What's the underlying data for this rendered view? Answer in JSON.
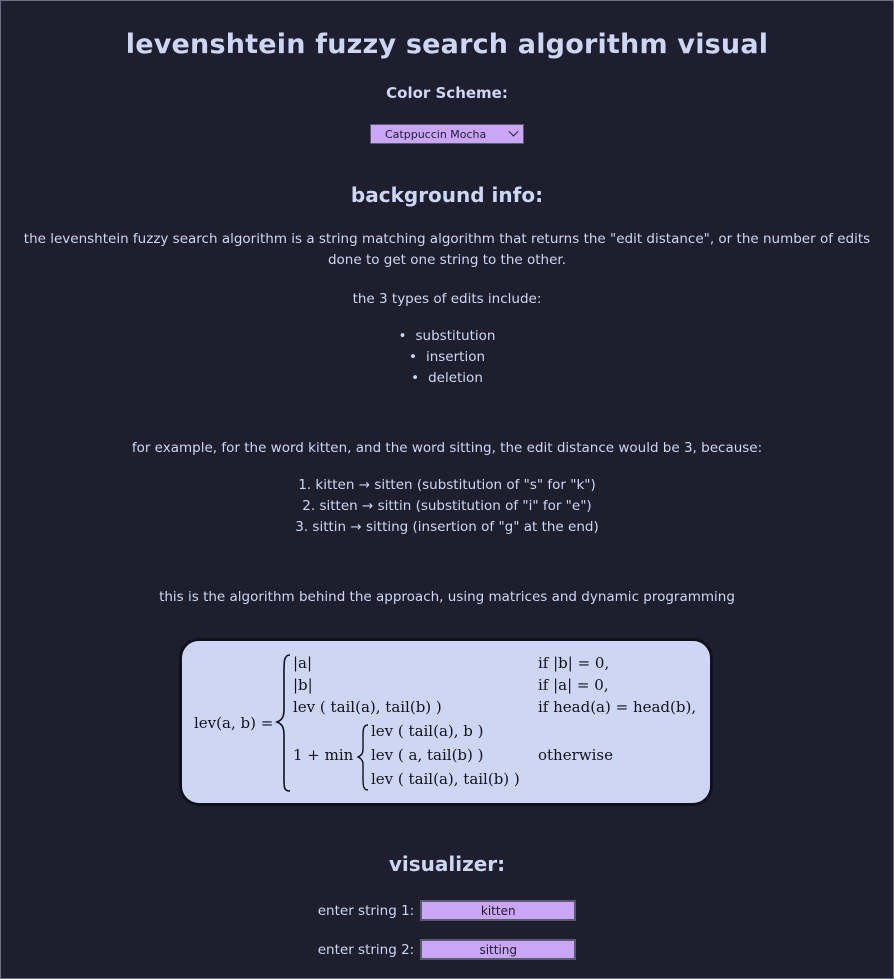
{
  "title": "levenshtein fuzzy search algorithm visual",
  "color_scheme": {
    "label": "Color Scheme:",
    "selected": "Catppuccin Mocha"
  },
  "background": {
    "heading": "background info:",
    "intro": "the levenshtein fuzzy search algorithm is a string matching algorithm that returns the \"edit distance\", or the number of edits done to get one string to the other.",
    "types_intro": "the 3 types of edits include:",
    "types": [
      "substitution",
      "insertion",
      "deletion"
    ],
    "example_intro": "for example, for the word kitten, and the word sitting, the edit distance would be 3, because:",
    "steps": [
      "1. kitten → sitten (substitution of \"s\" for \"k\")",
      "2. sitten → sittin (substitution of \"i\" for \"e\")",
      "3. sittin → sitting (insertion of \"g\" at the end)"
    ],
    "algo_intro": "this is the algorithm behind the approach, using matrices and dynamic programming"
  },
  "formula": {
    "lhs": "lev(a, b) =",
    "cases": [
      {
        "expr": "|a|",
        "cond": "if |b| = 0,"
      },
      {
        "expr": "|b|",
        "cond": "if |a| = 0,"
      },
      {
        "expr": "lev ( tail(a), tail(b) )",
        "cond": "if head(a) = head(b),"
      },
      {
        "expr": "1 + min",
        "cond": "otherwise"
      }
    ],
    "min_cases": [
      "lev ( tail(a), b )",
      "lev ( a, tail(b) )",
      "lev ( tail(a), tail(b) )"
    ]
  },
  "visualizer": {
    "heading": "visualizer:",
    "string1_label": "enter string 1:",
    "string1_value": "kitten",
    "string2_label": "enter string 2:",
    "string2_value": "sitting"
  },
  "colors": {
    "background": "#1e1e2e",
    "text": "#cdd6f4",
    "accent": "#cba6f7",
    "formula_bg": "#cdd6f4"
  }
}
